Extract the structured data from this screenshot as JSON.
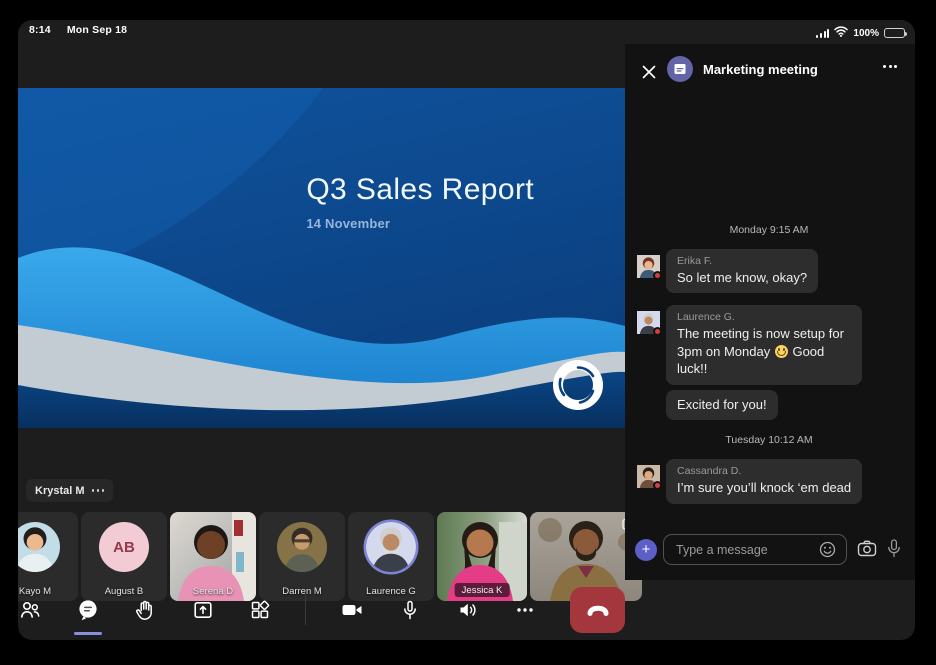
{
  "status_bar": {
    "time": "8:14",
    "date": "Mon Sep 18",
    "battery_percent": "100%"
  },
  "presentation": {
    "slide_title": "Q3 Sales Report",
    "slide_subtitle": "14 November",
    "presenter_name": "Krystal M"
  },
  "chat": {
    "title": "Marketing meeting",
    "day1_timestamp": "Monday 9:15 AM",
    "msg1": {
      "sender": "Erika F.",
      "text": "So let me know, okay?"
    },
    "msg2": {
      "sender": "Laurence G.",
      "text_before_emoji": "The meeting is now setup for 3pm on Monday ",
      "emoji": "😊",
      "text_after_emoji": " Good luck!!",
      "followup_text": "Excited for you!"
    },
    "day2_timestamp": "Tuesday 10:12 AM",
    "msg3": {
      "sender": "Cassandra D.",
      "text": "I’m sure you’ll knock ‘em dead"
    },
    "input_placeholder": "Type a message"
  },
  "participants": {
    "p0": {
      "name": "Kayo M"
    },
    "p1": {
      "name": "August B",
      "initials": "AB"
    },
    "p2": {
      "name": "Serena D"
    },
    "p3": {
      "name": "Darren M"
    },
    "p4": {
      "name": "Laurence G"
    },
    "p5": {
      "name": "Jessica K"
    }
  },
  "icons": {
    "status_bar": [
      "cellular-signal-icon",
      "wifi-icon",
      "battery-icon"
    ],
    "chat_header": [
      "close-icon",
      "teams-meeting-icon",
      "more-icon"
    ],
    "compose": [
      "add-icon",
      "emoji-icon",
      "camera-icon",
      "microphone-icon"
    ],
    "toolbar": [
      "people-icon",
      "chat-icon",
      "raise-hand-icon",
      "share-screen-icon",
      "apps-icon",
      "video-camera-icon",
      "microphone-icon",
      "speaker-icon",
      "more-icon",
      "hang-up-icon"
    ],
    "self_tile": [
      "switch-camera-icon"
    ]
  },
  "colors": {
    "accent_purple": "#6264a7",
    "compose_purple": "#5b5fc7",
    "hangup_red": "#a4373e",
    "presence_busy_red": "#d3403e",
    "slide_blue_top": "#0f539e",
    "slide_blue_bottom": "#07305f",
    "wave_light_blue": "#2f9fe2",
    "wave_gray": "#c3ccd2",
    "chat_bubble": "#2d2d2d",
    "panel_bg": "#121212",
    "screen_bg": "#1d1d1d"
  }
}
